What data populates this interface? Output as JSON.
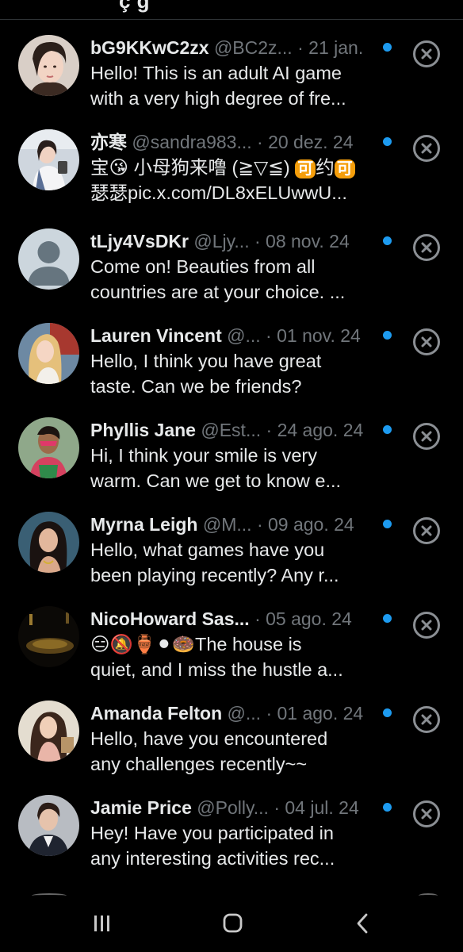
{
  "header": {
    "cut_title": "ç g"
  },
  "colors": {
    "background": "#000000",
    "unread_dot": "#1d9bf0",
    "muted_text": "#71767b",
    "primary_text": "#e7e9ea"
  },
  "conversations": [
    {
      "name": "bG9KKwC2zx",
      "handle": "@BC2z...",
      "separator": "·",
      "date": "21 jan.",
      "line1": "Hello! This is an adult AI game",
      "line2": "with a very high degree of fre...",
      "avatar": "woman-portrait"
    },
    {
      "name": "亦寒",
      "handle": "@sandra983...",
      "separator": "·",
      "date": "20 dez. 24",
      "line1_a": "宝😘 小母狗来噜 (≧▽≦) ",
      "line1_badge1": "可",
      "line1_b": "约",
      "line1_badge2": "可",
      "line2": "瑟瑟pic.x.com/DL8xELUwwU...",
      "avatar": "woman-selfie"
    },
    {
      "name": "tLjy4VsDKr",
      "handle": "@Ljy...",
      "separator": "·",
      "date": "08 nov. 24",
      "line1": "Come on! Beauties from all",
      "line2": "countries are at your choice. ...",
      "avatar": "default-avatar"
    },
    {
      "name": "Lauren Vincent",
      "handle": "@...",
      "separator": "·",
      "date": "01 nov. 24",
      "line1": "Hello, I think you have great",
      "line2": "taste. Can we be friends?",
      "avatar": "blonde-woman"
    },
    {
      "name": "Phyllis Jane",
      "handle": "@Est...",
      "separator": "·",
      "date": "24 ago. 24",
      "line1": "Hi, I think your smile is very",
      "line2": "warm. Can we get to know e...",
      "avatar": "man-sunglasses"
    },
    {
      "name": "Myrna Leigh",
      "handle": "@M...",
      "separator": "·",
      "date": "09 ago. 24",
      "line1": "Hello, what games have you",
      "line2": "been playing recently? Any r...",
      "avatar": "woman-dark-hair"
    },
    {
      "name": "NicoHoward Sas...",
      "handle": "",
      "separator": "·",
      "date": "05 ago. 24",
      "line1_emoji": "😑🔕🏺⚫🍩",
      "line1": "The house is",
      "line2": "quiet, and I miss the hustle a...",
      "avatar": "dark-lamp"
    },
    {
      "name": "Amanda Felton",
      "handle": "@...",
      "separator": "·",
      "date": "01 ago. 24",
      "line1": "Hello, have you encountered",
      "line2": "any challenges recently~~",
      "avatar": "woman-long-hair"
    },
    {
      "name": "Jamie Price",
      "handle": "@Polly...",
      "separator": "·",
      "date": "04 jul. 24",
      "line1": "Hey! Have you participated in",
      "line2": "any interesting activities rec...",
      "avatar": "man-suit"
    }
  ],
  "nav": {
    "recents_icon": "recents-icon",
    "home_icon": "home-icon",
    "back_icon": "back-icon"
  }
}
